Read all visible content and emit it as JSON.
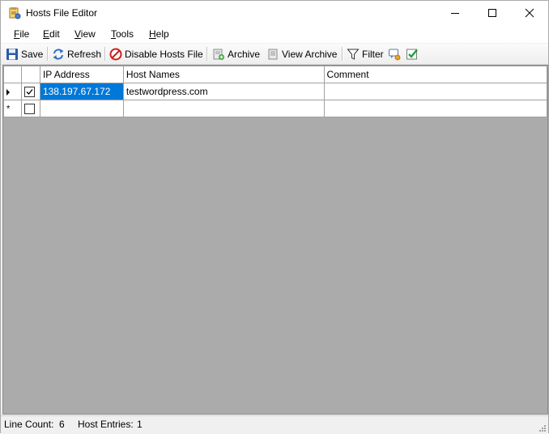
{
  "window": {
    "title": "Hosts File Editor",
    "controls": {
      "minimize_glyph": "—",
      "maximize_glyph": "☐",
      "close_glyph": "✕"
    }
  },
  "menu": {
    "items": [
      {
        "label": "File",
        "accel": "F",
        "rest": "ile"
      },
      {
        "label": "Edit",
        "accel": "E",
        "rest": "dit"
      },
      {
        "label": "View",
        "accel": "V",
        "rest": "iew"
      },
      {
        "label": "Tools",
        "accel": "T",
        "rest": "ools"
      },
      {
        "label": "Help",
        "accel": "H",
        "rest": "elp"
      }
    ]
  },
  "toolbar": {
    "save": "Save",
    "refresh": "Refresh",
    "disable": "Disable Hosts File",
    "archive": "Archive",
    "view_archive": "View Archive",
    "filter": "Filter"
  },
  "grid": {
    "columns": [
      "IP Address",
      "Host Names",
      "Comment"
    ],
    "rows": [
      {
        "enabled": true,
        "ip": "138.197.67.172",
        "host": "testwordpress.com",
        "comment": ""
      }
    ],
    "new_row_marker": "*"
  },
  "status": {
    "line_count_label": "Line Count:",
    "line_count": "6",
    "host_entries_label": "Host Entries:",
    "host_entries": "1"
  },
  "icons": {
    "app": "hosts-file-icon",
    "save": "floppy-disk-icon",
    "refresh": "refresh-arrows-icon",
    "disable": "no-entry-icon",
    "archive": "archive-add-icon",
    "view_archive": "archive-view-icon",
    "filter": "funnel-icon",
    "filter_extra": "comment-filter-icon",
    "check": "green-check-icon"
  },
  "colors": {
    "selection": "#0078d7",
    "grid_background": "#ababab"
  }
}
